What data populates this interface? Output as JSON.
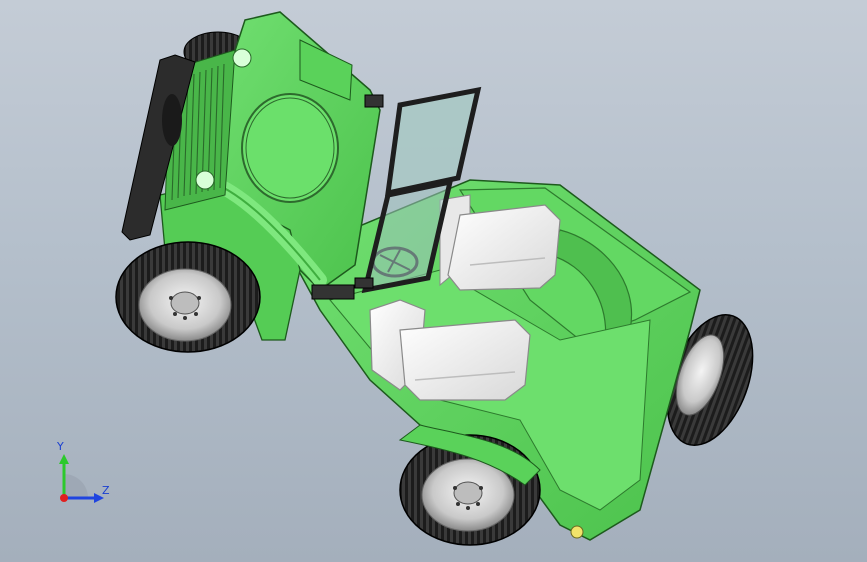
{
  "viewport": {
    "background_top": "#c4ccd6",
    "background_bottom": "#a4afbc"
  },
  "model": {
    "body_color": "#5cd65c",
    "body_shadow": "#3fae3f",
    "seat_color": "#f2f2f2",
    "tire_color": "#1e1e1e",
    "hub_color": "#cfcfcf",
    "glass_color": "#a8c8c4"
  },
  "triad": {
    "y_label": "Y",
    "z_label": "Z",
    "y_color": "#2cc92c",
    "z_color": "#1f44e0",
    "x_color": "#e02020"
  }
}
